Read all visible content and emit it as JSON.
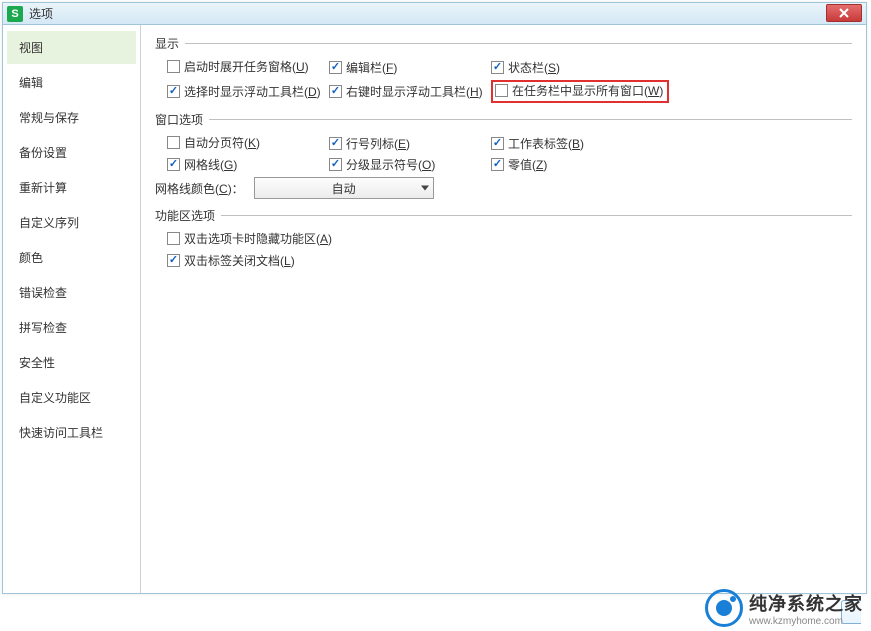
{
  "title": "选项",
  "sidebar": {
    "items": [
      {
        "label": "视图",
        "active": true
      },
      {
        "label": "编辑",
        "active": false
      },
      {
        "label": "常规与保存",
        "active": false
      },
      {
        "label": "备份设置",
        "active": false
      },
      {
        "label": "重新计算",
        "active": false
      },
      {
        "label": "自定义序列",
        "active": false
      },
      {
        "label": "颜色",
        "active": false
      },
      {
        "label": "错误检查",
        "active": false
      },
      {
        "label": "拼写检查",
        "active": false
      },
      {
        "label": "安全性",
        "active": false
      },
      {
        "label": "自定义功能区",
        "active": false
      },
      {
        "label": "快速访问工具栏",
        "active": false
      }
    ]
  },
  "groups": {
    "display": {
      "title": "显示",
      "items": [
        {
          "label": "启动时展开任务窗格",
          "key": "U",
          "checked": false
        },
        {
          "label": "编辑栏",
          "key": "F",
          "checked": true
        },
        {
          "label": "状态栏",
          "key": "S",
          "checked": true
        },
        {
          "label": "选择时显示浮动工具栏",
          "key": "D",
          "checked": true
        },
        {
          "label": "右键时显示浮动工具栏",
          "key": "H",
          "checked": true
        },
        {
          "label": "在任务栏中显示所有窗口",
          "key": "W",
          "checked": false,
          "highlight": true
        }
      ]
    },
    "window": {
      "title": "窗口选项",
      "items": [
        {
          "label": "自动分页符",
          "key": "K",
          "checked": false
        },
        {
          "label": "行号列标",
          "key": "E",
          "checked": true
        },
        {
          "label": "工作表标签",
          "key": "B",
          "checked": true
        },
        {
          "label": "网格线",
          "key": "G",
          "checked": true
        },
        {
          "label": "分级显示符号",
          "key": "O",
          "checked": true
        },
        {
          "label": "零值",
          "key": "Z",
          "checked": true
        }
      ],
      "gridcolor_label": "网格线颜色",
      "gridcolor_key": "C",
      "gridcolor_value": "自动"
    },
    "ribbon": {
      "title": "功能区选项",
      "items": [
        {
          "label": "双击选项卡时隐藏功能区",
          "key": "A",
          "checked": false
        },
        {
          "label": "双击标签关闭文档",
          "key": "L",
          "checked": true
        }
      ]
    }
  },
  "watermark": {
    "title": "纯净系统之家",
    "url": "www.kzmyhome.com"
  }
}
